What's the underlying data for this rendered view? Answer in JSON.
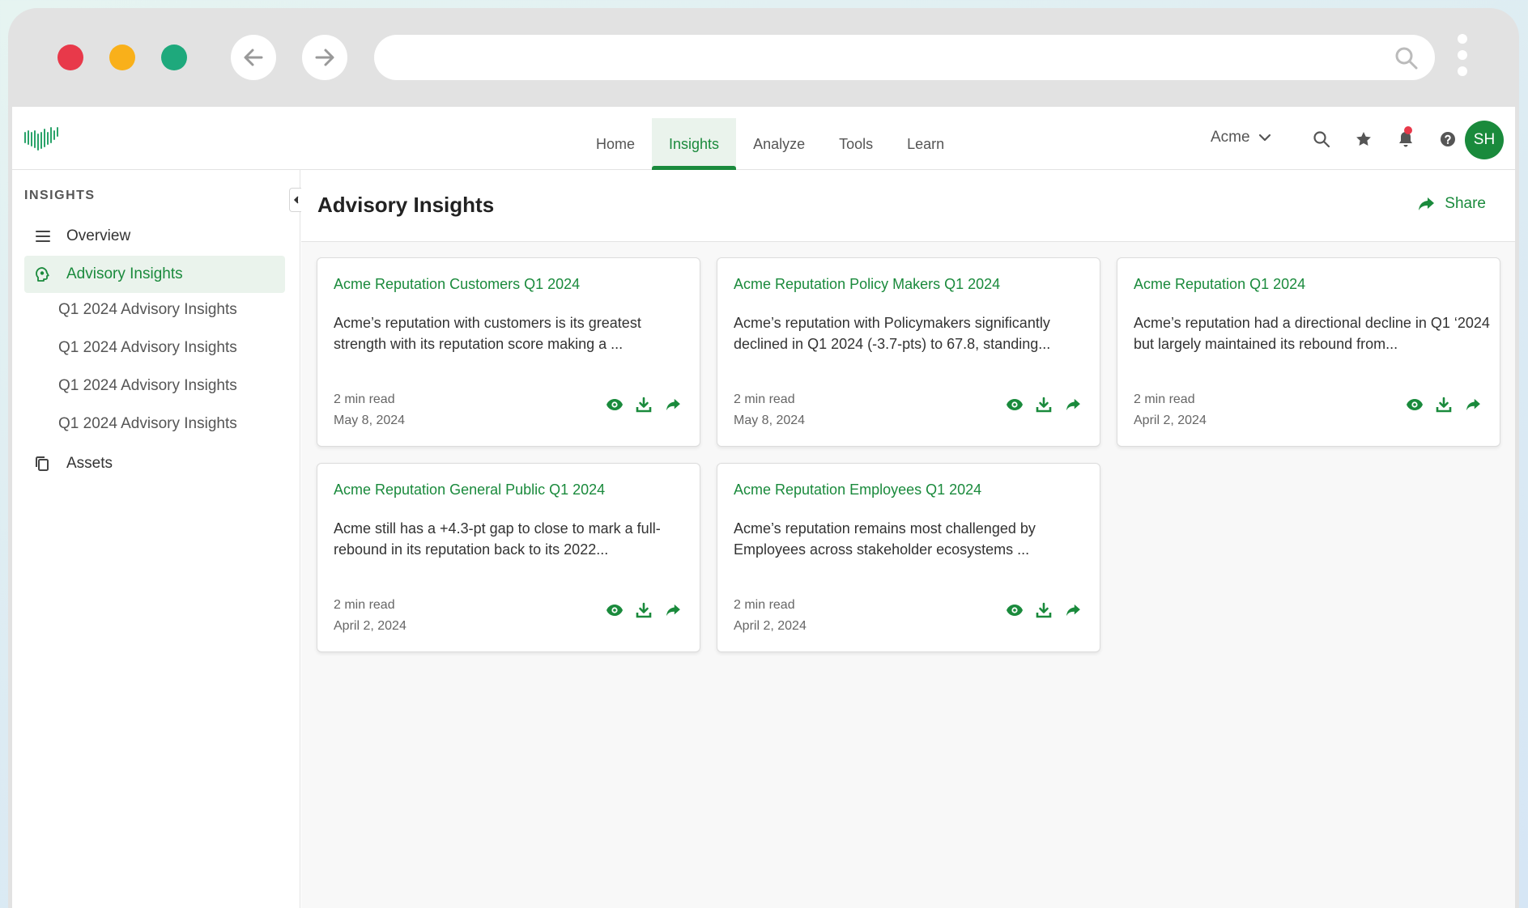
{
  "browser": {
    "address_value": "",
    "icons": [
      "back-arrow-icon",
      "forward-arrow-icon",
      "search-icon",
      "kebab-menu-icon"
    ]
  },
  "app": {
    "nav_tabs": [
      {
        "label": "Home"
      },
      {
        "label": "Insights"
      },
      {
        "label": "Analyze"
      },
      {
        "label": "Tools"
      },
      {
        "label": "Learn"
      }
    ],
    "active_tab": "Insights",
    "org_name": "Acme",
    "avatar_initials": "SH",
    "colors": {
      "accent": "#1a8a3c",
      "notification": "#e8394a"
    }
  },
  "sidebar": {
    "title": "INSIGHTS",
    "items": [
      {
        "label": "Overview",
        "icon": "list-icon"
      },
      {
        "label": "Advisory Insights",
        "icon": "head-bulb-icon"
      },
      {
        "label": "Q1 2024 Advisory Insights"
      },
      {
        "label": "Q1 2024 Advisory Insights"
      },
      {
        "label": "Q1 2024 Advisory Insights"
      },
      {
        "label": "Q1 2024 Advisory Insights"
      },
      {
        "label": "Assets",
        "icon": "copy-icon"
      }
    ]
  },
  "main": {
    "title": "Advisory Insights",
    "share_label": "Share",
    "cards": [
      {
        "title": "Acme Reputation Customers Q1 2024",
        "text": "Acme’s reputation with customers is its greatest strength with its reputation score making a ...",
        "read": "2 min read",
        "date": "May 8, 2024"
      },
      {
        "title": "Acme Reputation Policy Makers Q1 2024",
        "text": "Acme’s reputation with Policymakers significantly declined in Q1 2024 (-3.7-pts) to 67.8, standing...",
        "read": "2 min read",
        "date": "May 8, 2024"
      },
      {
        "title": "Acme Reputation Q1 2024",
        "text": "Acme’s reputation had a directional decline in Q1 ‘2024 but largely maintained its rebound from...",
        "read": "2 min read",
        "date": "April 2, 2024"
      },
      {
        "title": "Acme Reputation General Public Q1 2024",
        "text": "Acme still has a +4.3-pt gap to close to mark a full-rebound in its reputation back to its 2022...",
        "read": "2 min read",
        "date": "April 2, 2024"
      },
      {
        "title": "Acme Reputation Employees Q1 2024",
        "text": "Acme’s reputation remains most challenged by Employees across stakeholder ecosystems ...",
        "read": "2 min read",
        "date": "April 2, 2024"
      }
    ]
  }
}
